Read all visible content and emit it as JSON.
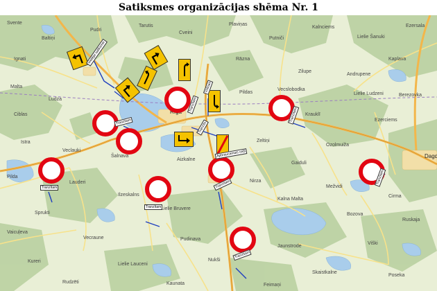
{
  "title": "Satiksmes organizācijas shēma Nr. 1",
  "colors": {
    "map_background": "#e9efd6",
    "forest": "#b7cf9e",
    "water": "#a9cdeb",
    "road_main": "#f3b64a",
    "road_secondary": "#f7e28b",
    "settlement": "#f2dfa8",
    "stop_sign_ring": "#e20612",
    "warning_sign": "#f4c200",
    "route_line": "#1f3fbf"
  },
  "places": {
    "riga": "Rīga",
    "dagda": "Dagd",
    "svente": "Svente",
    "baltini": "Baltiņi",
    "pudri": "Pudri",
    "tarutis": "Tarutis",
    "cveini": "Cveini",
    "plavinas": "Plaviņas",
    "putnici": "Putniči",
    "kalnciems": "Kalnciems",
    "lielie_sanuki": "Lielie Šanuki",
    "ezersala": "Ezersala",
    "ignati": "Ignati",
    "razna": "Rāzna",
    "zilupe": "Zilupe",
    "kaplava": "Kaplava",
    "malta": "Malta",
    "ludza": "Ludza",
    "pildas": "Pildas",
    "vecslobodka": "Vecslobodka",
    "lielie_ludzeni": "Lielie Ludzeni",
    "berezovka": "Berezovka",
    "ciblas": "Ciblas",
    "kraukli": "Krauklī",
    "ezerciems": "Ezerciems",
    "istra": "Istra",
    "veclauki": "Veclauki",
    "zeltini": "Zeltiņi",
    "ozolmuiza": "Ozolmuiža",
    "andrupene": "Andrupene",
    "salnava": "Šalnava",
    "aizkalne": "Aizkalne",
    "gaiduli": "Gaiduli",
    "pilda": "Pilda",
    "lauderi": "Lauderi",
    "nirza": "Nirza",
    "mezvidi": "Mežvidi",
    "cirma": "Cirma",
    "ilzeskalns": "Ilzeskalns",
    "kalna_malta": "Kalna Malta",
    "sprukti": "Sprukti",
    "lielie_bruvere": "Lielie Bruvere",
    "bozova": "Bozova",
    "ruskaja": "Ruskaja",
    "vaicuļeva": "Vaicuļeva",
    "vecraune": "Vecraune",
    "pudinava": "Pudinava",
    "jaunstrode": "Jaunstrode",
    "viski": "Viški",
    "kureri": "Kureri",
    "lielie_lauceni": "Lielie Lauceni",
    "nukši": "Nukši",
    "skaistkalne": "Skaistkalne",
    "poseka": "Poseka",
    "rudzeti": "Rudzēti",
    "kaunata": "Kaunata",
    "feimani": "Feimaņi"
  },
  "plates": {
    "tranzitam_1": "Tranzītam",
    "tranzitam_2": "Tranzītam",
    "tranzitam_3": "Tranzītam",
    "tranzitam_4": "Tranzītam",
    "tranzitam_5": "Tranzītam",
    "tranzitam_6": "Tranzītam",
    "tranzitam_7": "Tranzītam",
    "tranzitam_8": "Tranzītam",
    "vietejai": "Vietējai satiksmei",
    "apbraucamais": "Apbraucamais ceļš",
    "transit_small": "Tranzīts",
    "vidinas": "Vidiņas"
  }
}
